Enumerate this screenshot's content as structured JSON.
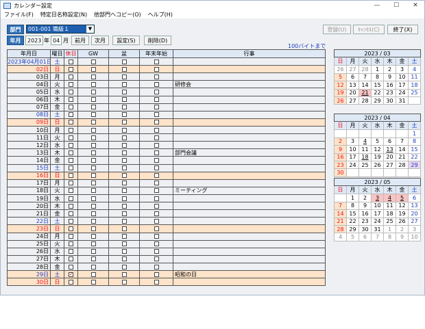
{
  "window": {
    "title": "カレンダー設定"
  },
  "menu": [
    "ファイル(F)",
    "特定日名称設定(N)",
    "他部門へコピー(O)",
    "ヘルプ(H)"
  ],
  "toolbar": {
    "dept_label": "部門",
    "dept_value": "001-001 職級１",
    "register": "登録(U)",
    "cancel": "ｷｬﾝｾﾙ(C)",
    "exit": "終了(X)",
    "ym_label": "年月",
    "year": "2023",
    "year_unit": "年",
    "month": "04",
    "month_unit": "月",
    "prev": "前月",
    "next": "次月",
    "set": "設定(S)",
    "del": "削除(D)",
    "limit_note": "100バイトまで"
  },
  "grid": {
    "headers": [
      "年月日",
      "曜日",
      "休日",
      "GW",
      "盆",
      "年末年始",
      "行事"
    ],
    "rows": [
      {
        "d": "2023年04月01日",
        "w": "土",
        "hol": false,
        "ev": "",
        "cls": "blu",
        "chk": false
      },
      {
        "d": "02日",
        "w": "日",
        "hol": true,
        "ev": "",
        "cls": "red",
        "chk": false
      },
      {
        "d": "03日",
        "w": "月",
        "hol": false,
        "ev": "",
        "cls": "",
        "chk": false
      },
      {
        "d": "04日",
        "w": "火",
        "hol": false,
        "ev": "研修会",
        "cls": "",
        "chk": false
      },
      {
        "d": "05日",
        "w": "水",
        "hol": false,
        "ev": "",
        "cls": "",
        "chk": false
      },
      {
        "d": "06日",
        "w": "木",
        "hol": false,
        "ev": "",
        "cls": "",
        "chk": false
      },
      {
        "d": "07日",
        "w": "金",
        "hol": false,
        "ev": "",
        "cls": "",
        "chk": false
      },
      {
        "d": "08日",
        "w": "土",
        "hol": false,
        "ev": "",
        "cls": "blu",
        "chk": false
      },
      {
        "d": "09日",
        "w": "日",
        "hol": true,
        "ev": "",
        "cls": "red",
        "chk": false
      },
      {
        "d": "10日",
        "w": "月",
        "hol": false,
        "ev": "",
        "cls": "",
        "chk": false
      },
      {
        "d": "11日",
        "w": "火",
        "hol": false,
        "ev": "",
        "cls": "",
        "chk": false
      },
      {
        "d": "12日",
        "w": "水",
        "hol": false,
        "ev": "",
        "cls": "",
        "chk": false
      },
      {
        "d": "13日",
        "w": "木",
        "hol": false,
        "ev": "部門会議",
        "cls": "",
        "chk": false
      },
      {
        "d": "14日",
        "w": "金",
        "hol": false,
        "ev": "",
        "cls": "",
        "chk": false
      },
      {
        "d": "15日",
        "w": "土",
        "hol": false,
        "ev": "",
        "cls": "blu",
        "chk": false
      },
      {
        "d": "16日",
        "w": "日",
        "hol": true,
        "ev": "",
        "cls": "red",
        "chk": false
      },
      {
        "d": "17日",
        "w": "月",
        "hol": false,
        "ev": "",
        "cls": "",
        "chk": false
      },
      {
        "d": "18日",
        "w": "火",
        "hol": false,
        "ev": "ミーティング",
        "cls": "",
        "chk": false
      },
      {
        "d": "19日",
        "w": "水",
        "hol": false,
        "ev": "",
        "cls": "",
        "chk": false
      },
      {
        "d": "20日",
        "w": "木",
        "hol": false,
        "ev": "",
        "cls": "",
        "chk": false
      },
      {
        "d": "21日",
        "w": "金",
        "hol": false,
        "ev": "",
        "cls": "",
        "chk": false
      },
      {
        "d": "22日",
        "w": "土",
        "hol": false,
        "ev": "",
        "cls": "blu",
        "chk": false
      },
      {
        "d": "23日",
        "w": "日",
        "hol": true,
        "ev": "",
        "cls": "red",
        "chk": false
      },
      {
        "d": "24日",
        "w": "月",
        "hol": false,
        "ev": "",
        "cls": "",
        "chk": false
      },
      {
        "d": "25日",
        "w": "火",
        "hol": false,
        "ev": "",
        "cls": "",
        "chk": false
      },
      {
        "d": "26日",
        "w": "水",
        "hol": false,
        "ev": "",
        "cls": "",
        "chk": false
      },
      {
        "d": "27日",
        "w": "木",
        "hol": false,
        "ev": "",
        "cls": "",
        "chk": false
      },
      {
        "d": "28日",
        "w": "金",
        "hol": false,
        "ev": "",
        "cls": "",
        "chk": false
      },
      {
        "d": "29日",
        "w": "土",
        "hol": true,
        "ev": "昭和の日",
        "cls": "blu",
        "chk": true
      },
      {
        "d": "30日",
        "w": "日",
        "hol": true,
        "ev": "",
        "cls": "red",
        "chk": false
      }
    ]
  },
  "calendars": [
    {
      "title": "2023 / 03",
      "weekdays": [
        "日",
        "月",
        "火",
        "水",
        "木",
        "金",
        "土"
      ],
      "weeks": [
        [
          "26",
          "27",
          "28",
          "1",
          "2",
          "3",
          "4"
        ],
        [
          "5",
          "6",
          "7",
          "8",
          "9",
          "10",
          "11"
        ],
        [
          "12",
          "13",
          "14",
          "15",
          "16",
          "17",
          "18"
        ],
        [
          "19",
          "20",
          "21",
          "22",
          "23",
          "24",
          "25"
        ],
        [
          "26",
          "27",
          "28",
          "29",
          "30",
          "31",
          ""
        ]
      ],
      "other": [
        [
          0,
          0
        ],
        [
          0,
          1
        ],
        [
          0,
          2
        ]
      ],
      "holidays": [
        [
          3,
          2
        ]
      ],
      "underline": [
        [
          3,
          2
        ]
      ],
      "purple": []
    },
    {
      "title": "2023 / 04",
      "weekdays": [
        "日",
        "月",
        "火",
        "水",
        "木",
        "金",
        "土"
      ],
      "weeks": [
        [
          "",
          "",
          "",
          "",
          "",
          "",
          "1"
        ],
        [
          "2",
          "3",
          "4",
          "5",
          "6",
          "7",
          "8"
        ],
        [
          "9",
          "10",
          "11",
          "12",
          "13",
          "14",
          "15"
        ],
        [
          "16",
          "17",
          "18",
          "19",
          "20",
          "21",
          "22"
        ],
        [
          "23",
          "24",
          "25",
          "26",
          "27",
          "28",
          "29"
        ],
        [
          "30",
          "",
          "",
          "",
          "",
          "",
          ""
        ]
      ],
      "other": [],
      "holidays": [],
      "underline": [
        [
          1,
          2
        ],
        [
          2,
          4
        ],
        [
          3,
          2
        ]
      ],
      "purple": [
        [
          4,
          6
        ]
      ]
    },
    {
      "title": "2023 / 05",
      "weekdays": [
        "日",
        "月",
        "火",
        "水",
        "木",
        "金",
        "土"
      ],
      "weeks": [
        [
          "",
          "1",
          "2",
          "3",
          "4",
          "5",
          "6"
        ],
        [
          "7",
          "8",
          "9",
          "10",
          "11",
          "12",
          "13"
        ],
        [
          "14",
          "15",
          "16",
          "17",
          "18",
          "19",
          "20"
        ],
        [
          "21",
          "22",
          "23",
          "24",
          "25",
          "26",
          "27"
        ],
        [
          "28",
          "29",
          "30",
          "31",
          "1",
          "2",
          "3"
        ],
        [
          "4",
          "5",
          "6",
          "7",
          "8",
          "9",
          "10"
        ]
      ],
      "other": [
        [
          4,
          4
        ],
        [
          4,
          5
        ],
        [
          4,
          6
        ],
        [
          5,
          0
        ],
        [
          5,
          1
        ],
        [
          5,
          2
        ],
        [
          5,
          3
        ],
        [
          5,
          4
        ],
        [
          5,
          5
        ],
        [
          5,
          6
        ]
      ],
      "holidays": [
        [
          0,
          3
        ],
        [
          0,
          4
        ],
        [
          0,
          5
        ]
      ],
      "underline": [
        [
          0,
          3
        ],
        [
          0,
          4
        ],
        [
          0,
          5
        ]
      ],
      "purple": []
    }
  ]
}
